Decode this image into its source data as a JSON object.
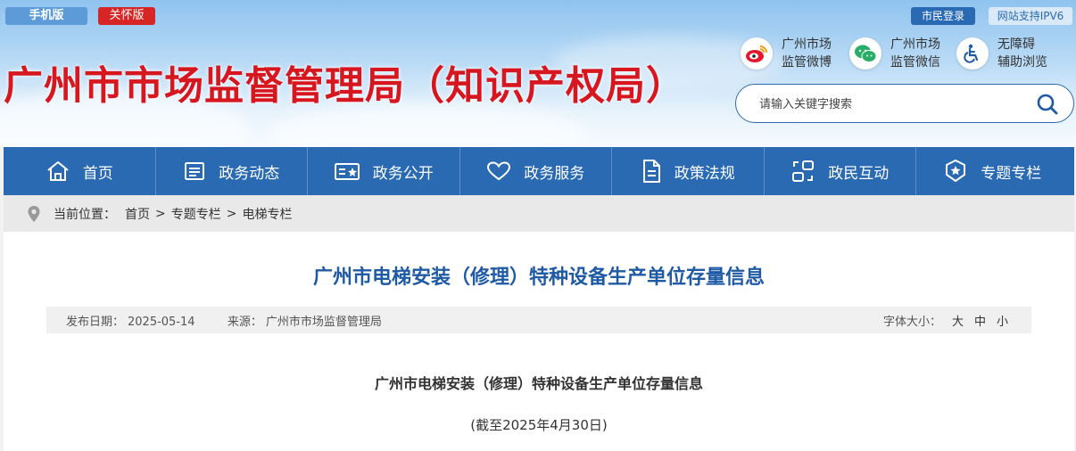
{
  "header": {
    "mobile_label": "手机版",
    "care_label": "关怀版",
    "login_label": "市民登录",
    "ipv6_label": "网站支持IPV6",
    "site_title": "广州市市场监督管理局（知识产权局）",
    "weibo": {
      "line1": "广州市场",
      "line2": "监管微博",
      "icon": "weibo-icon"
    },
    "wechat": {
      "line1": "广州市场",
      "line2": "监管微信",
      "icon": "wechat-icon"
    },
    "access": {
      "line1": "无障碍",
      "line2": "辅助浏览",
      "icon": "accessibility-icon"
    },
    "search_placeholder": "请输入关键字搜索",
    "search_value": ""
  },
  "nav": {
    "items": [
      {
        "label": "首页",
        "icon": "home-icon"
      },
      {
        "label": "政务动态",
        "icon": "news-icon"
      },
      {
        "label": "政务公开",
        "icon": "open-icon"
      },
      {
        "label": "政务服务",
        "icon": "heart-icon"
      },
      {
        "label": "政策法规",
        "icon": "document-icon"
      },
      {
        "label": "政民互动",
        "icon": "interaction-icon"
      },
      {
        "label": "专题专栏",
        "icon": "badge-icon"
      }
    ]
  },
  "breadcrumb": {
    "prefix": "当前位置：",
    "items": [
      "首页",
      "专题专栏",
      "电梯专栏"
    ],
    "separator": ">"
  },
  "article": {
    "title": "广州市电梯安装（修理）特种设备生产单位存量信息",
    "publish_label": "发布日期：",
    "publish_date": "2025-05-14",
    "source_label": "来源：",
    "source": "广州市市场监督管理局",
    "font_size_label": "字体大小：",
    "font_sizes": [
      "大",
      "中",
      "小"
    ],
    "body_title": "广州市电梯安装（修理）特种设备生产单位存量信息",
    "body_date": "(截至2025年4月30日)"
  },
  "colors": {
    "brand_blue": "#2a6ab3",
    "title_red": "#d7171f",
    "article_title_blue": "#1f5aa5"
  }
}
